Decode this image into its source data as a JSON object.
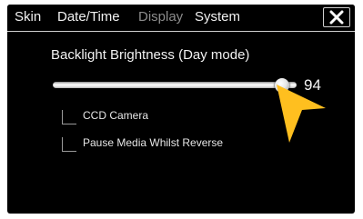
{
  "tabs": [
    {
      "label": "Skin",
      "enabled": true
    },
    {
      "label": "Date/Time",
      "enabled": true
    },
    {
      "label": "Display",
      "enabled": false
    },
    {
      "label": "System",
      "enabled": true,
      "selected": true
    }
  ],
  "close_icon": "close-icon",
  "backlight": {
    "label": "Backlight Brightness (Day mode)",
    "value": "94",
    "level_percent": 94
  },
  "options": [
    {
      "label": "CCD Camera",
      "checked": false
    },
    {
      "label": "Pause Media Whilst Reverse",
      "checked": false
    }
  ],
  "colors": {
    "background": "#000000",
    "text": "#f2f2f2",
    "disabled_text": "#8c8c8c",
    "pointer": "#ffbf1f"
  },
  "icons": {
    "pointer": "pointer-arrow-icon"
  }
}
